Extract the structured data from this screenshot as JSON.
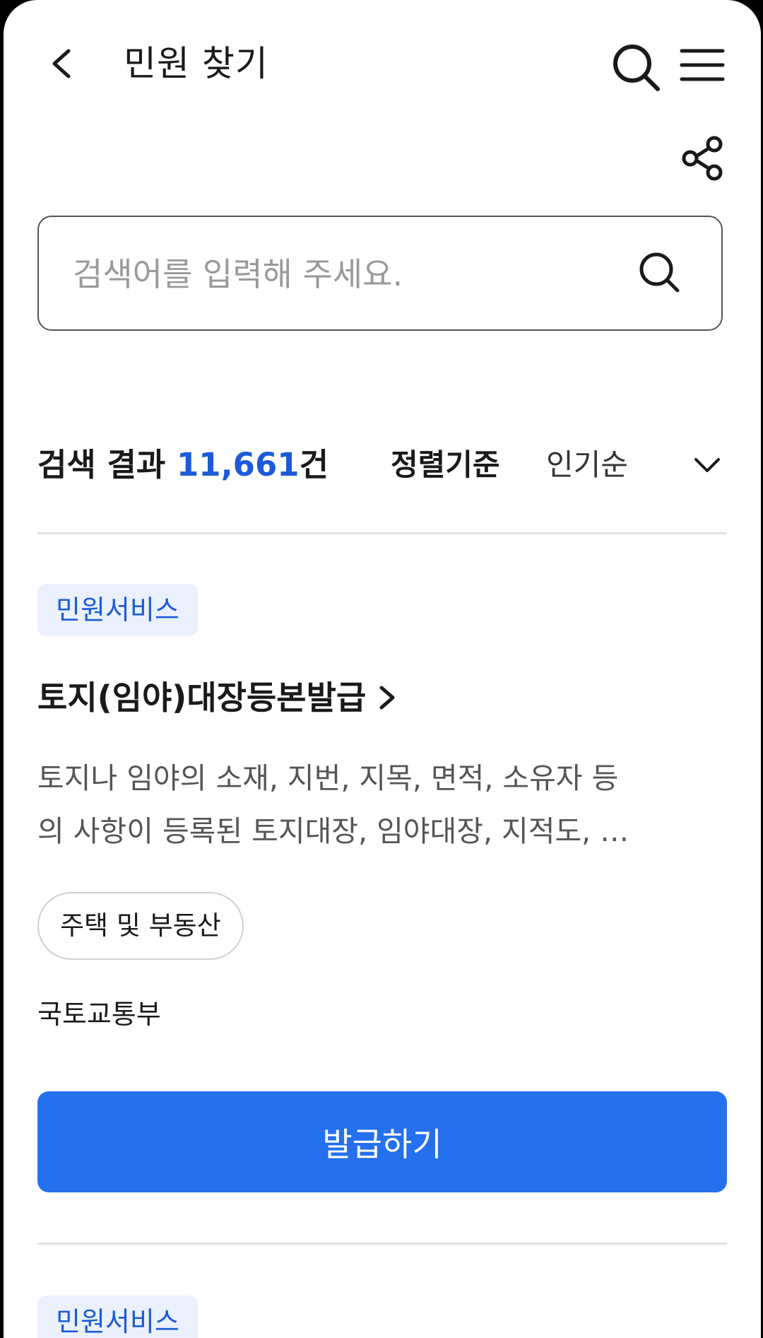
{
  "header": {
    "title": "민원 찾기"
  },
  "search": {
    "placeholder": "검색어를 입력해 주세요.",
    "value": ""
  },
  "results": {
    "label": "검색 결과",
    "count": "11,661",
    "unit": "건",
    "sort_label": "정렬기준",
    "sort_value": "인기순"
  },
  "items": [
    {
      "category": "민원서비스",
      "title": "토지(임야)대장등본발급",
      "description_lines": [
        "토지나 임야의 소재, 지번, 지목, 면적, 소유자 등",
        "의 사항이 등록된 토지대장, 임야대장, 지적도, …"
      ],
      "tag": "주택 및 부동산",
      "agency": "국토교통부",
      "action_label": "발급하기"
    },
    {
      "category": "민원서비스"
    }
  ],
  "colors": {
    "accent": "#2570ef",
    "count_blue": "#1c5ad8",
    "badge_bg": "#eaf1fd"
  },
  "icons": {
    "back": "chevron-left-icon",
    "search": "search-icon",
    "menu": "hamburger-menu-icon",
    "share": "share-icon",
    "sort": "chevron-down-icon",
    "title_link": "chevron-right-icon"
  }
}
